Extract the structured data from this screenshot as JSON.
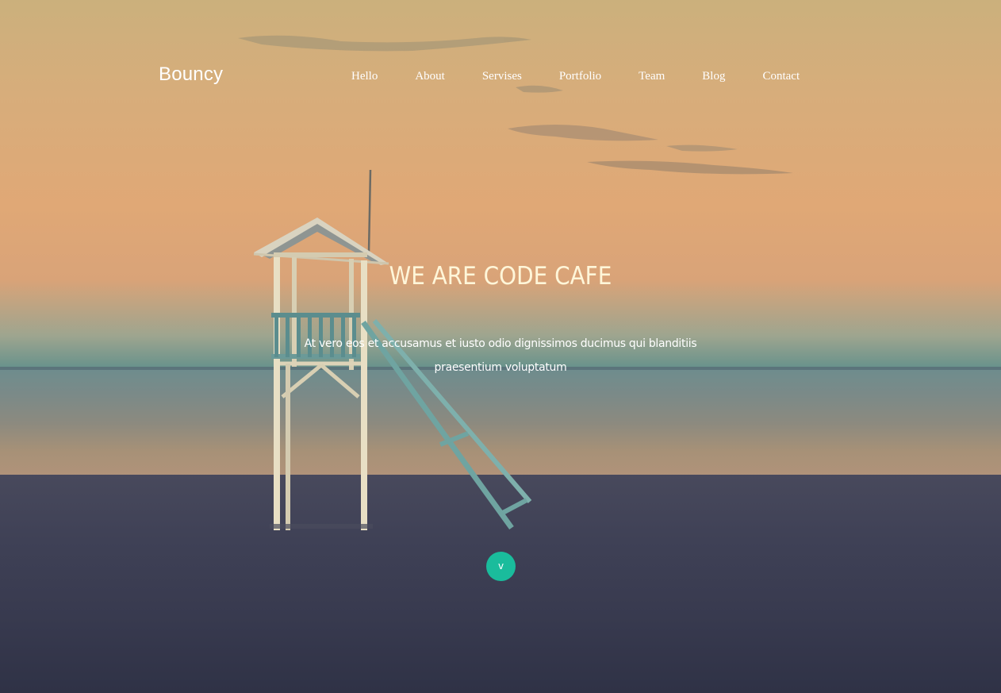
{
  "brand": "Bouncy",
  "nav": {
    "items": [
      {
        "label": "Hello"
      },
      {
        "label": "About"
      },
      {
        "label": "Servises"
      },
      {
        "label": "Portfolio"
      },
      {
        "label": "Team"
      },
      {
        "label": "Blog"
      },
      {
        "label": "Contact"
      }
    ]
  },
  "hero": {
    "title": "WE ARE CODE CAFE",
    "subtitle_line1": "At vero eos et accusamus et iusto odio dignissimos ducimus qui blanditiis",
    "subtitle_line2": "praesentium voluptatum",
    "scroll_label": "v"
  },
  "colors": {
    "accent": "#1abc9c",
    "title": "#fff6d9",
    "text": "#ffffff"
  },
  "icons": {
    "scroll": "chevron-down-icon"
  }
}
